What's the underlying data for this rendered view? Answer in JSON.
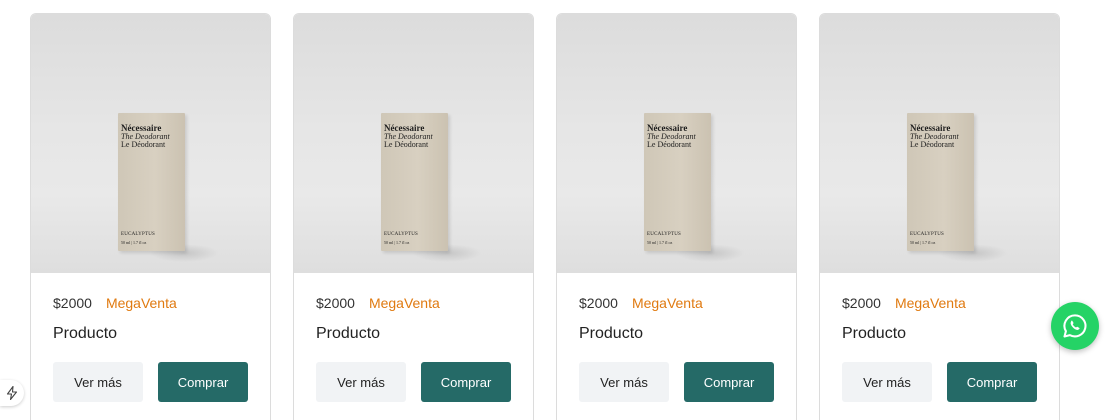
{
  "products": [
    {
      "price": "$2000",
      "brand": "MegaVenta",
      "title": "Producto",
      "more_label": "Ver más",
      "buy_label": "Comprar",
      "image": {
        "line1": "Nécessaire",
        "line2": "The Deodorant",
        "line3": "Le Déodorant",
        "scent": "EUCALYPTUS",
        "size": "50 ml | 1.7 fl oz"
      }
    },
    {
      "price": "$2000",
      "brand": "MegaVenta",
      "title": "Producto",
      "more_label": "Ver más",
      "buy_label": "Comprar",
      "image": {
        "line1": "Nécessaire",
        "line2": "The Deodorant",
        "line3": "Le Déodorant",
        "scent": "EUCALYPTUS",
        "size": "50 ml | 1.7 fl oz"
      }
    },
    {
      "price": "$2000",
      "brand": "MegaVenta",
      "title": "Producto",
      "more_label": "Ver más",
      "buy_label": "Comprar",
      "image": {
        "line1": "Nécessaire",
        "line2": "The Deodorant",
        "line3": "Le Déodorant",
        "scent": "EUCALYPTUS",
        "size": "50 ml | 1.7 fl oz"
      }
    },
    {
      "price": "$2000",
      "brand": "MegaVenta",
      "title": "Producto",
      "more_label": "Ver más",
      "buy_label": "Comprar",
      "image": {
        "line1": "Nécessaire",
        "line2": "The Deodorant",
        "line3": "Le Déodorant",
        "scent": "EUCALYPTUS",
        "size": "50 ml | 1.7 fl oz"
      }
    }
  ],
  "colors": {
    "brand_orange": "#e07a10",
    "buy_button": "#256a67",
    "more_button": "#f1f3f5",
    "whatsapp": "#25d366"
  },
  "icons": {
    "floating_chat": "whatsapp-icon",
    "corner_widget": "lightning-icon"
  }
}
